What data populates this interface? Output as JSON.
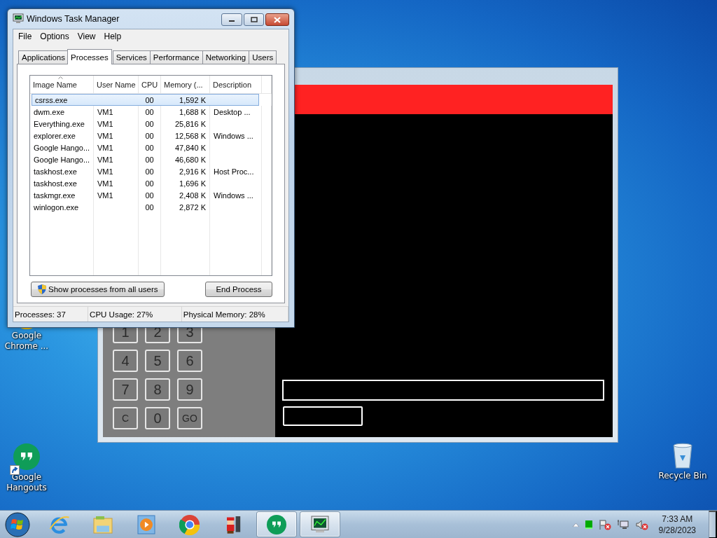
{
  "desktop_icons": [
    {
      "kind": "chrome",
      "label": "Google Chrome ...",
      "shortcut": false
    },
    {
      "kind": "hangouts",
      "label": "Google Hangouts",
      "shortcut": true
    },
    {
      "kind": "recycle",
      "label": "Recycle Bin",
      "shortcut": false
    }
  ],
  "keypad_window": {
    "keys": [
      {
        "label": "1",
        "kind": "digit"
      },
      {
        "label": "2",
        "kind": "digit"
      },
      {
        "label": "3",
        "kind": "digit"
      },
      {
        "label": "4",
        "kind": "digit"
      },
      {
        "label": "5",
        "kind": "digit"
      },
      {
        "label": "6",
        "kind": "digit"
      },
      {
        "label": "7",
        "kind": "digit"
      },
      {
        "label": "8",
        "kind": "digit"
      },
      {
        "label": "9",
        "kind": "digit"
      },
      {
        "label": "C",
        "kind": "command"
      },
      {
        "label": "0",
        "kind": "digit"
      },
      {
        "label": "GO",
        "kind": "command"
      }
    ]
  },
  "task_manager": {
    "title": "Windows Task Manager",
    "menu": [
      "File",
      "Options",
      "View",
      "Help"
    ],
    "tabs": [
      {
        "label": "Applications",
        "selected": false
      },
      {
        "label": "Processes",
        "selected": true
      },
      {
        "label": "Services",
        "selected": false
      },
      {
        "label": "Performance",
        "selected": false
      },
      {
        "label": "Networking",
        "selected": false
      },
      {
        "label": "Users",
        "selected": false
      }
    ],
    "columns": [
      "Image Name",
      "User Name",
      "CPU",
      "Memory (...",
      "Description"
    ],
    "rows": [
      {
        "cells": [
          "csrss.exe",
          "",
          "00",
          "1,592 K",
          ""
        ],
        "selected": true
      },
      {
        "cells": [
          "dwm.exe",
          "VM1",
          "00",
          "1,688 K",
          "Desktop ..."
        ],
        "selected": false
      },
      {
        "cells": [
          "Everything.exe",
          "VM1",
          "00",
          "25,816 K",
          ""
        ],
        "selected": false
      },
      {
        "cells": [
          "explorer.exe",
          "VM1",
          "00",
          "12,568 K",
          "Windows ..."
        ],
        "selected": false
      },
      {
        "cells": [
          "Google Hango...",
          "VM1",
          "00",
          "47,840 K",
          ""
        ],
        "selected": false
      },
      {
        "cells": [
          "Google Hango...",
          "VM1",
          "00",
          "46,680 K",
          ""
        ],
        "selected": false
      },
      {
        "cells": [
          "taskhost.exe",
          "VM1",
          "00",
          "2,916 K",
          "Host Proc..."
        ],
        "selected": false
      },
      {
        "cells": [
          "taskhost.exe",
          "VM1",
          "00",
          "1,696 K",
          ""
        ],
        "selected": false
      },
      {
        "cells": [
          "taskmgr.exe",
          "VM1",
          "00",
          "2,408 K",
          "Windows ..."
        ],
        "selected": false
      },
      {
        "cells": [
          "winlogon.exe",
          "",
          "00",
          "2,872 K",
          ""
        ],
        "selected": false
      }
    ],
    "show_all_button": "Show processes from all users",
    "end_button": "End Process",
    "status": [
      "Processes: 37",
      "CPU Usage: 27%",
      "Physical Memory: 28%"
    ]
  },
  "taskbar": {
    "items": [
      {
        "kind": "ie",
        "running": false
      },
      {
        "kind": "folder",
        "running": false
      },
      {
        "kind": "media",
        "running": false
      },
      {
        "kind": "chrome",
        "running": false
      },
      {
        "kind": "game",
        "running": false
      },
      {
        "kind": "hangouts",
        "running": true
      },
      {
        "kind": "taskmgr",
        "running": true
      }
    ],
    "time": "7:33 AM",
    "date": "9/28/2023"
  }
}
